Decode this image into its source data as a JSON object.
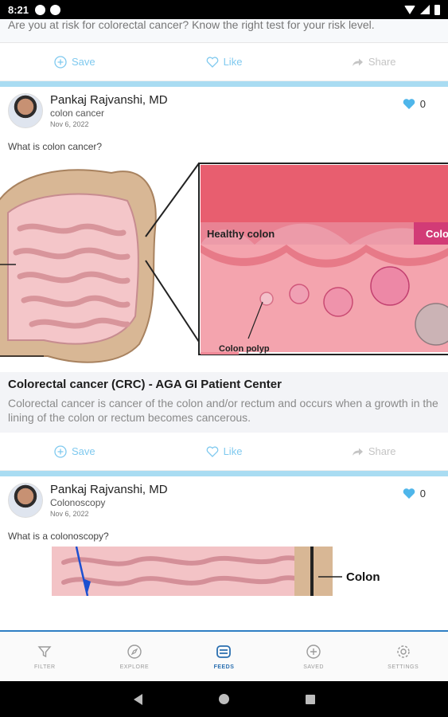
{
  "status_bar": {
    "time": "8:21"
  },
  "previous_post": {
    "description": "Are you at risk for colorectal cancer? Know the right test for your risk level.",
    "actions": {
      "save": "Save",
      "like": "Like",
      "share": "Share"
    }
  },
  "posts": [
    {
      "author": "Pankaj Rajvanshi, MD",
      "topic": "colon cancer",
      "date": "Nov 6, 2022",
      "likes": "0",
      "question": "What is colon cancer?",
      "image_labels": {
        "healthy": "Healthy colon",
        "healthy_cut": "Colo",
        "polyp": "Colon polyp"
      },
      "link_title": "Colorectal cancer (CRC) - AGA GI Patient Center",
      "link_description": "Colorectal cancer is cancer of the colon and/or rectum and occurs when a growth in the lining of the colon or rectum becomes cancerous.",
      "actions": {
        "save": "Save",
        "like": "Like",
        "share": "Share"
      }
    },
    {
      "author": "Pankaj Rajvanshi, MD",
      "topic": "Colonoscopy",
      "date": "Nov 6, 2022",
      "likes": "0",
      "question": "What is a colonoscopy?",
      "image_labels": {
        "colon": "Colon"
      }
    }
  ],
  "bottom_nav": [
    {
      "label": "FILTER",
      "icon": "filter-icon",
      "active": false
    },
    {
      "label": "EXPLORE",
      "icon": "compass-icon",
      "active": false
    },
    {
      "label": "FEEDS",
      "icon": "feeds-icon",
      "active": true
    },
    {
      "label": "SAVED",
      "icon": "saved-icon",
      "active": false
    },
    {
      "label": "SETTINGS",
      "icon": "gear-icon",
      "active": false
    }
  ],
  "colors": {
    "accent": "#7fc9ef",
    "nav_active": "#2a6fb0",
    "divider": "#a9dcf2",
    "heart": "#4fb6ea"
  }
}
